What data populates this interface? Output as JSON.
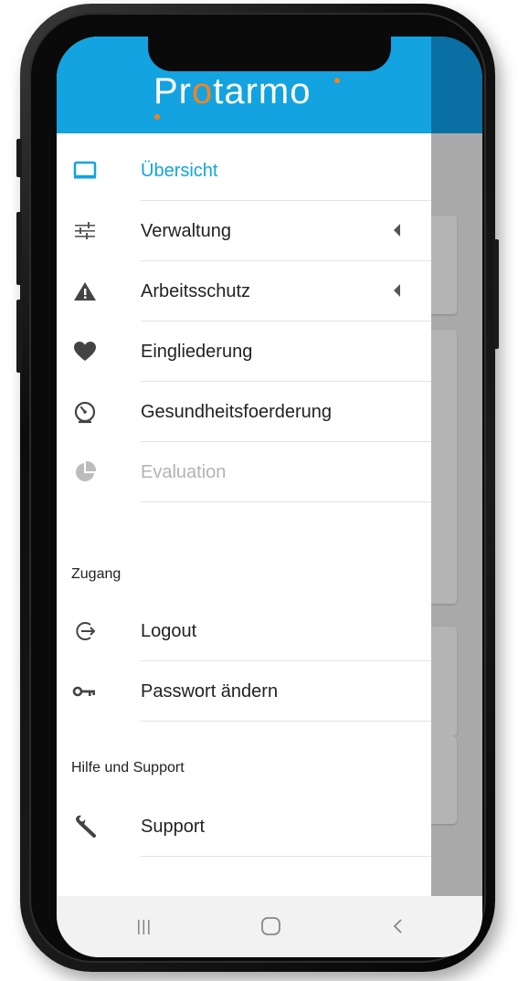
{
  "header": {
    "logo_prefix": "Pr",
    "logo_accent": "o",
    "logo_suffix": "tarmo"
  },
  "menu": {
    "items": [
      {
        "label": "Übersicht",
        "icon": "monitor-icon",
        "active": true
      },
      {
        "label": "Verwaltung",
        "icon": "sliders-icon",
        "has_submenu": true
      },
      {
        "label": "Arbeitsschutz",
        "icon": "warning-icon",
        "has_submenu": true
      },
      {
        "label": "Eingliederung",
        "icon": "heart-icon"
      },
      {
        "label": "Gesundheitsfoerderung",
        "icon": "gauge-icon"
      },
      {
        "label": "Evaluation",
        "icon": "pie-chart-icon",
        "disabled": true
      }
    ]
  },
  "access": {
    "heading": "Zugang",
    "items": [
      {
        "label": "Logout",
        "icon": "logout-icon"
      },
      {
        "label": "Passwort ändern",
        "icon": "key-icon"
      }
    ]
  },
  "help": {
    "heading": "Hilfe und Support",
    "items": [
      {
        "label": "Support",
        "icon": "wrench-icon"
      }
    ]
  },
  "system_nav": {
    "buttons": [
      "recent-apps-icon",
      "home-icon",
      "back-icon"
    ]
  },
  "colors": {
    "primary": "#12a3e0",
    "accent": "#f58220",
    "text": "#222222",
    "disabled": "#b3b3b3"
  }
}
